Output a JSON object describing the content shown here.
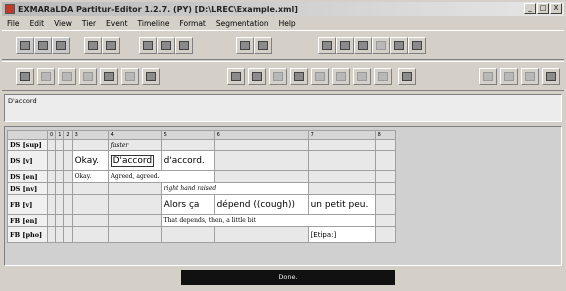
{
  "window": {
    "title": "EXMARaLDA Partitur-Editor 1.2.7. (PY) [D:\\LREC\\Example.xml]",
    "buttons": [
      "_",
      "□",
      "X"
    ]
  },
  "menu": [
    "File",
    "Edit",
    "View",
    "Tier",
    "Event",
    "Timeline",
    "Format",
    "Segmentation",
    "Help"
  ],
  "description_text": "D'accord",
  "timeline": [
    "0",
    "1",
    "2",
    "3",
    "4",
    "5",
    "6",
    "7",
    "8"
  ],
  "rows": [
    {
      "tier": "DS [sup]",
      "cells": {
        "c4": "faster"
      }
    },
    {
      "tier": "DS [v]",
      "cells": {
        "c3": "Okay.",
        "c4": "D'accord",
        "c5": "d'accord."
      }
    },
    {
      "tier": "DS [en]",
      "cells": {
        "c3": "Okay.",
        "c4": "Agreed, agreed."
      }
    },
    {
      "tier": "DS [nv]",
      "cells": {
        "c5": "right hand raised"
      }
    },
    {
      "tier": "FB [v]",
      "cells": {
        "c5": "Alors ça",
        "c6": "dépend ((cough))",
        "c7": "un petit peu."
      }
    },
    {
      "tier": "FB [en]",
      "cells": {
        "c5": "That depends, then, a little bit"
      }
    },
    {
      "tier": "FB [pho]",
      "cells": {
        "c7": "[Etipa:]"
      }
    }
  ],
  "status": "Done."
}
